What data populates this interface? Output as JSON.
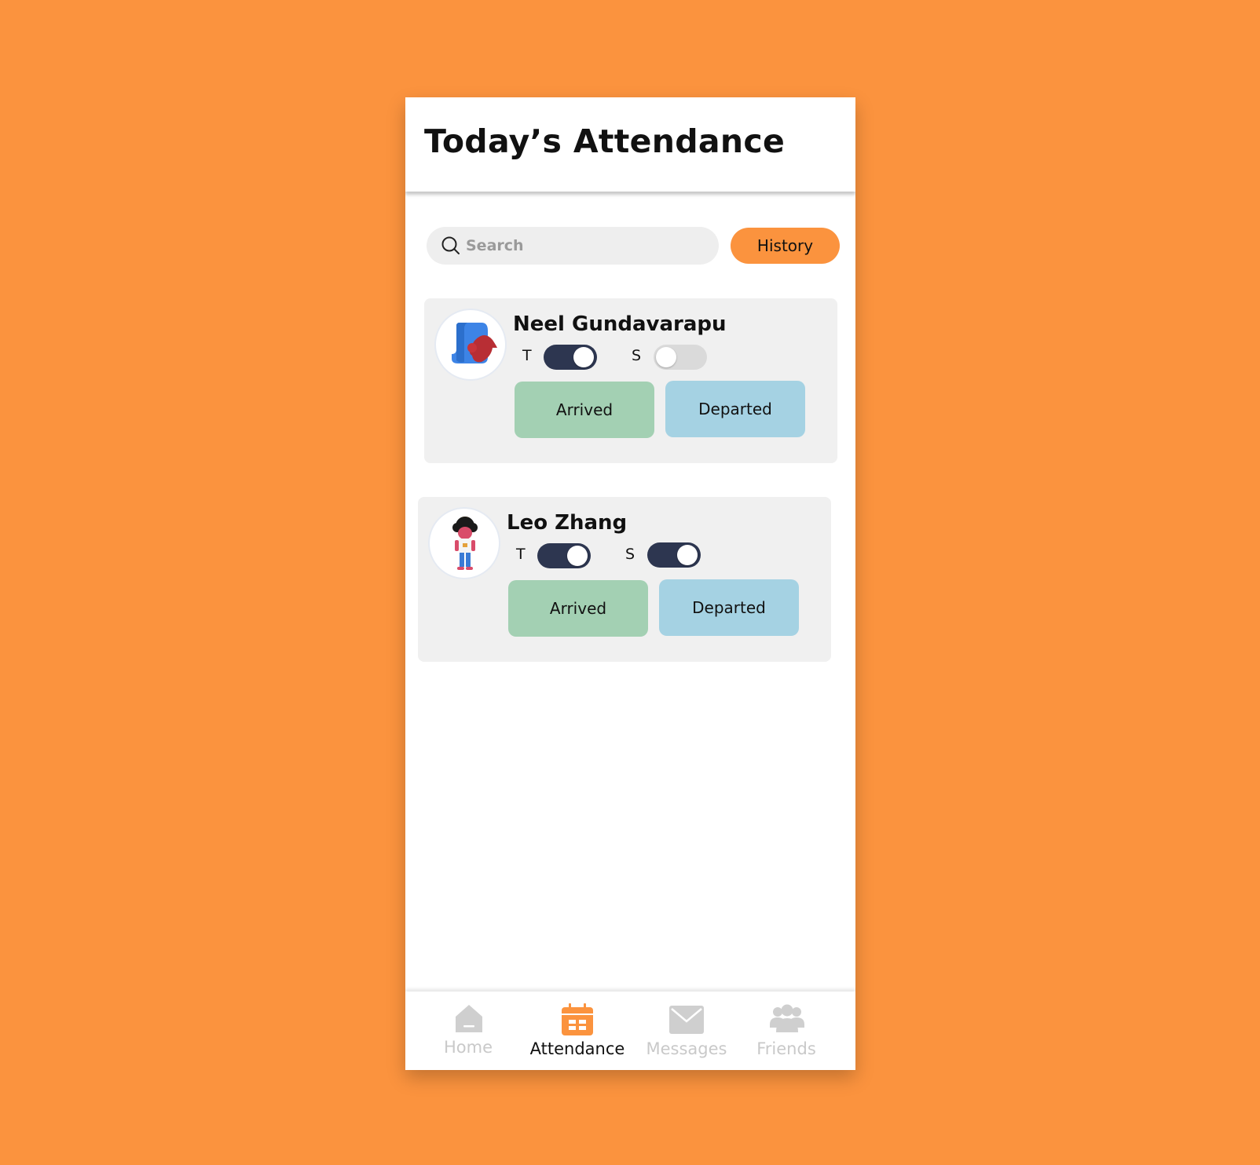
{
  "header": {
    "title": "Today’s Attendance"
  },
  "search": {
    "placeholder": "Search",
    "icon": "search-icon"
  },
  "history_button": {
    "label": "History",
    "color": "#FB933E"
  },
  "students": [
    {
      "name": "Neel Gundavarapu",
      "t_label": "T",
      "t_on": true,
      "s_label": "S",
      "s_on": false,
      "arrived_label": "Arrived",
      "departed_label": "Departed"
    },
    {
      "name": "Leo Zhang",
      "t_label": "T",
      "t_on": true,
      "s_label": "S",
      "s_on": true,
      "arrived_label": "Arrived",
      "departed_label": "Departed"
    }
  ],
  "nav": {
    "items": [
      {
        "label": "Home",
        "icon": "home-icon",
        "active": false
      },
      {
        "label": "Attendance",
        "icon": "calendar-icon",
        "active": true
      },
      {
        "label": "Messages",
        "icon": "envelope-icon",
        "active": false
      },
      {
        "label": "Friends",
        "icon": "people-icon",
        "active": false
      }
    ]
  },
  "colors": {
    "background": "#FB933E",
    "accent": "#FB933E",
    "toggle_on": "#2D3650",
    "arrived": "#A3D0B3",
    "departed": "#A5D2E3",
    "inactive_nav": "#C9C9C9"
  }
}
